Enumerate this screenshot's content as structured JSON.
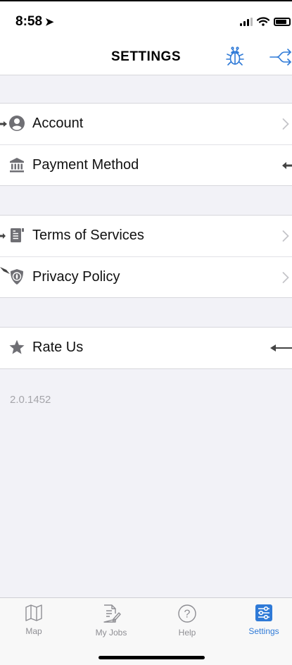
{
  "status_bar": {
    "time": "8:58"
  },
  "header": {
    "title": "SETTINGS"
  },
  "groups": {
    "account": [
      {
        "label": "Account",
        "icon": "user-circle-icon"
      },
      {
        "label": "Payment Method",
        "icon": "bank-icon"
      }
    ],
    "legal": [
      {
        "label": "Terms of Services",
        "icon": "document-icon"
      },
      {
        "label": "Privacy Policy",
        "icon": "shield-icon"
      }
    ],
    "feedback": [
      {
        "label": "Rate Us",
        "icon": "star-icon"
      }
    ]
  },
  "version": "2.0.1452",
  "tabs": [
    {
      "label": "Map",
      "icon": "map-icon",
      "active": false
    },
    {
      "label": "My Jobs",
      "icon": "document-edit-icon",
      "active": false
    },
    {
      "label": "Help",
      "icon": "help-icon",
      "active": false
    },
    {
      "label": "Settings",
      "icon": "sliders-icon",
      "active": true
    }
  ],
  "colors": {
    "accent": "#2f7ad7",
    "background": "#f2f2f7",
    "icon_gray": "#6f6f74"
  }
}
